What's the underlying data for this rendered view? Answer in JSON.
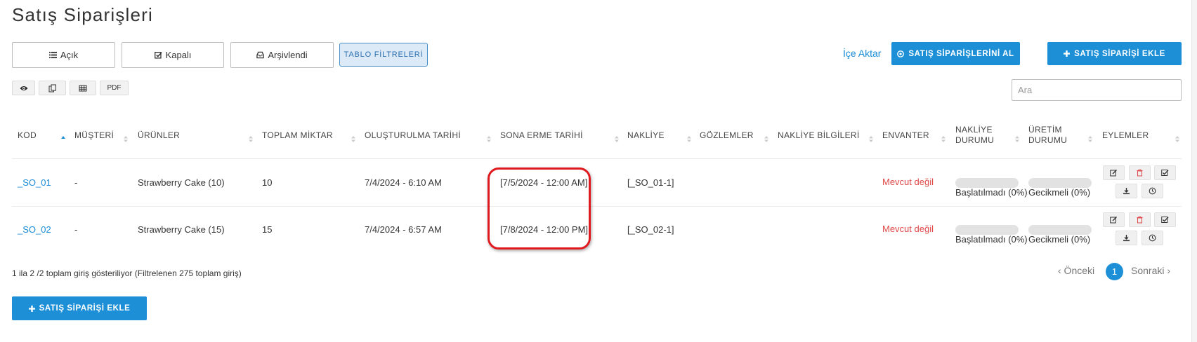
{
  "page": {
    "title": "Satış Siparişleri"
  },
  "tabs": [
    {
      "label": "Açık",
      "icon": "list-icon"
    },
    {
      "label": "Kapalı",
      "icon": "check-square-icon"
    },
    {
      "label": "Arşivlendi",
      "icon": "inbox-icon"
    }
  ],
  "table_filters_label": "TABLO FİLTRELERİ",
  "toolbar": {
    "import_label": "İçe Aktar",
    "get_orders_label": "SATIŞ SİPARİŞLERİNİ AL",
    "add_order_label": "SATIŞ SİPARİŞİ EKLE"
  },
  "export_buttons": {
    "pdf_label": "PDF"
  },
  "search": {
    "placeholder": "Ara"
  },
  "columns": {
    "kod": "KOD",
    "musteri": "MÜŞTERİ",
    "urunler": "ÜRÜNLER",
    "toplam_miktar": "TOPLAM MİKTAR",
    "olusturulma": "OLUŞTURULMA TARİHİ",
    "sona_erme": "SONA ERME TARİHİ",
    "nakliye": "NAKLİYE",
    "gozlemler": "GÖZLEMLER",
    "nakliye_bilgileri": "NAKLİYE BİLGİLERİ",
    "envanter": "ENVANTER",
    "nakliye_durumu_1": "NAKLİYE",
    "nakliye_durumu_2": "DURUMU",
    "uretim_durumu_1": "ÜRETİM",
    "uretim_durumu_2": "DURUMU",
    "eylemler": "EYLEMLER"
  },
  "rows": [
    {
      "kod": "_SO_01",
      "musteri": "-",
      "urunler": "Strawberry Cake (10)",
      "toplam_miktar": "10",
      "olusturulma": "7/4/2024 - 6:10 AM",
      "sona_erme": "[7/5/2024 - 12:00 AM]",
      "nakliye": "[_SO_01-1]",
      "envanter": "Mevcut değil",
      "nakliye_durumu": {
        "label": "Başlatılmadı (0%)",
        "progress": 0
      },
      "uretim_durumu": {
        "label": "Gecikmeli (0%)",
        "progress": 0
      }
    },
    {
      "kod": "_SO_02",
      "musteri": "-",
      "urunler": "Strawberry Cake (15)",
      "toplam_miktar": "15",
      "olusturulma": "7/4/2024 - 6:57 AM",
      "sona_erme": "[7/8/2024 - 12:00 PM]",
      "nakliye": "[_SO_02-1]",
      "envanter": "Mevcut değil",
      "nakliye_durumu": {
        "label": "Başlatılmadı (0%)",
        "progress": 0
      },
      "uretim_durumu": {
        "label": "Gecikmeli (0%)",
        "progress": 0
      }
    }
  ],
  "footer": {
    "info": "1 ila 2 /2 toplam giriş gösteriliyor (Filtrelenen 275 toplam giriş)",
    "prev_label": "‹ Önceki",
    "page": "1",
    "next_label": "Sonraki ›"
  },
  "bottom_add_label": "SATIŞ SİPARİŞİ EKLE",
  "colors": {
    "primary": "#1c8fd6",
    "danger": "#e04848",
    "highlight": "#e0191f"
  }
}
